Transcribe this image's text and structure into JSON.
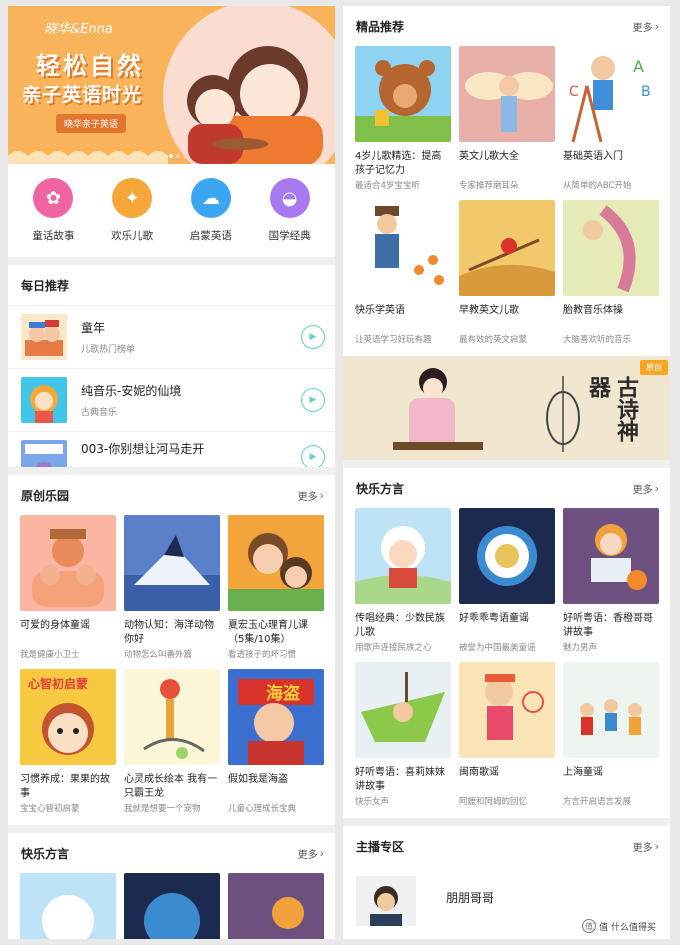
{
  "banner": {
    "brand": "晓华&Enna",
    "line1": "轻松自然",
    "line2": "亲子英语时光",
    "tag": "晓华亲子英语"
  },
  "categories": [
    {
      "label": "童话故事",
      "icon": "fairy-tale-icon",
      "color": "#f064a4"
    },
    {
      "label": "欢乐儿歌",
      "icon": "bird-icon",
      "color": "#f7a73a"
    },
    {
      "label": "启蒙英语",
      "icon": "abc-cloud-icon",
      "color": "#3ba7f4"
    },
    {
      "label": "国学经典",
      "icon": "fan-icon",
      "color": "#a77bf0"
    }
  ],
  "daily": {
    "title": "每日推荐",
    "items": [
      {
        "title": "童年",
        "sub": "儿歌热门榜单"
      },
      {
        "title": "纯音乐-安妮的仙境",
        "sub": "古典音乐"
      },
      {
        "title": "003-你别想让河马走开",
        "sub": ""
      }
    ]
  },
  "original": {
    "title": "原创乐园",
    "more": "更多",
    "cards": [
      {
        "title": "可爱的身体童谣",
        "sub": "我是健康小卫士"
      },
      {
        "title": "动物认知：海洋动物你好",
        "sub": "动物怎么叫番外篇"
      },
      {
        "title": "夏宏玉心理育儿课（5集/10集）",
        "sub": "看透孩子的坏习惯"
      },
      {
        "title": "习惯养成：果果的故事",
        "sub": "宝宝心智初启蒙"
      },
      {
        "title": "心灵成长绘本 我有一只霸王龙",
        "sub": "我就是想要一个宠物"
      },
      {
        "title": "假如我是海盗",
        "sub": "儿童心理成长宝典"
      }
    ],
    "thumb2_text": "海盗",
    "thumb4_text": "心智初启蒙"
  },
  "dialect_left": {
    "title": "快乐方言",
    "more": "更多"
  },
  "premium": {
    "title": "精品推荐",
    "more": "更多",
    "cards": [
      {
        "title": "4岁儿歌精选：提高孩子记忆力",
        "sub": "最适合4岁宝宝听"
      },
      {
        "title": "英文儿歌大全",
        "sub": "专家推荐磨耳朵"
      },
      {
        "title": "基础英语入门",
        "sub": "从简单的ABC开始"
      },
      {
        "title": "快乐学英语",
        "sub": "让英语学习好玩有趣"
      },
      {
        "title": "早教英文儿歌",
        "sub": "最有效的英文启蒙"
      },
      {
        "title": "胎教音乐体操",
        "sub": "大脑喜欢听的音乐"
      }
    ]
  },
  "poetry_banner": {
    "badge": "原创",
    "title": "古诗神器"
  },
  "dialect_right": {
    "title": "快乐方言",
    "more": "更多",
    "cards": [
      {
        "title": "传唱经典：少数民族儿歌",
        "sub": "用歌声连接民族之心"
      },
      {
        "title": "好乖乖粤语童谣",
        "sub": "被誉为中国最美童谣"
      },
      {
        "title": "好听粤语：香橙哥哥讲故事",
        "sub": "魅力男声"
      },
      {
        "title": "好听粤语：喜莉妹妹讲故事",
        "sub": "快乐女声"
      },
      {
        "title": "闽南歌谣",
        "sub": "阿嬷和阿姆的回忆"
      },
      {
        "title": "上海童谣",
        "sub": "方言开启语言发展"
      }
    ]
  },
  "anchor": {
    "title": "主播专区",
    "more": "更多",
    "host_name": "朋朋哥哥"
  },
  "watermark": "值 什么值得买"
}
